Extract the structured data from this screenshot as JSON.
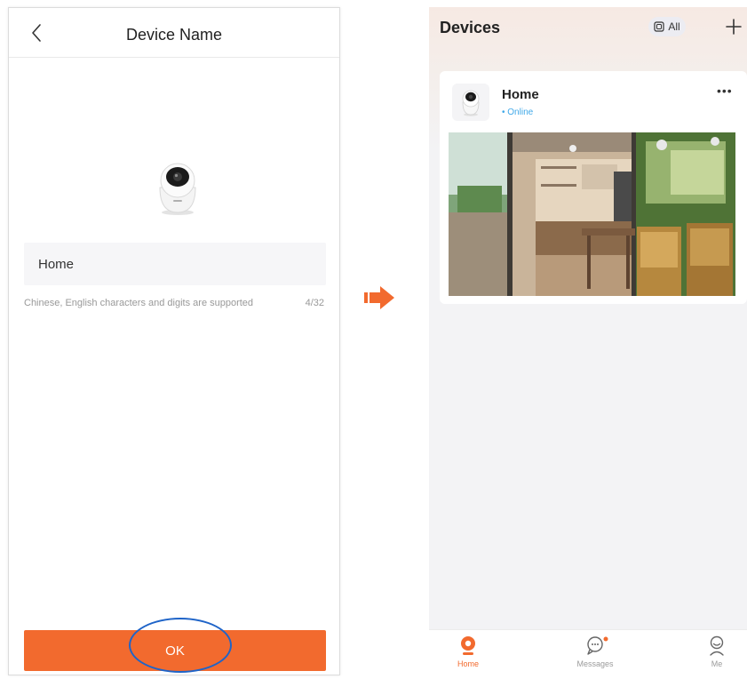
{
  "left_screen": {
    "title": "Device Name",
    "device_name_value": "Home",
    "hint": "Chinese, English characters and digits are supported",
    "counter": "4/32",
    "ok_label": "OK",
    "colors": {
      "accent": "#f26a2e",
      "highlight_ellipse": "#1f64c8"
    },
    "icons": [
      "chevron-left-icon",
      "camera-icon"
    ]
  },
  "transition_arrow": {
    "icon": "arrow-right-icon",
    "color": "#f26a2e"
  },
  "right_screen": {
    "title": "Devices",
    "filter_label": "All",
    "device": {
      "name": "Home",
      "status": "• Online",
      "status_color": "#3fa8e8"
    },
    "tabs": [
      {
        "label": "Home",
        "active": true,
        "icon": "home-camera-icon"
      },
      {
        "label": "Messages",
        "active": false,
        "icon": "message-icon",
        "has_dot": true
      },
      {
        "label": "Me",
        "active": false,
        "icon": "user-icon"
      }
    ]
  }
}
